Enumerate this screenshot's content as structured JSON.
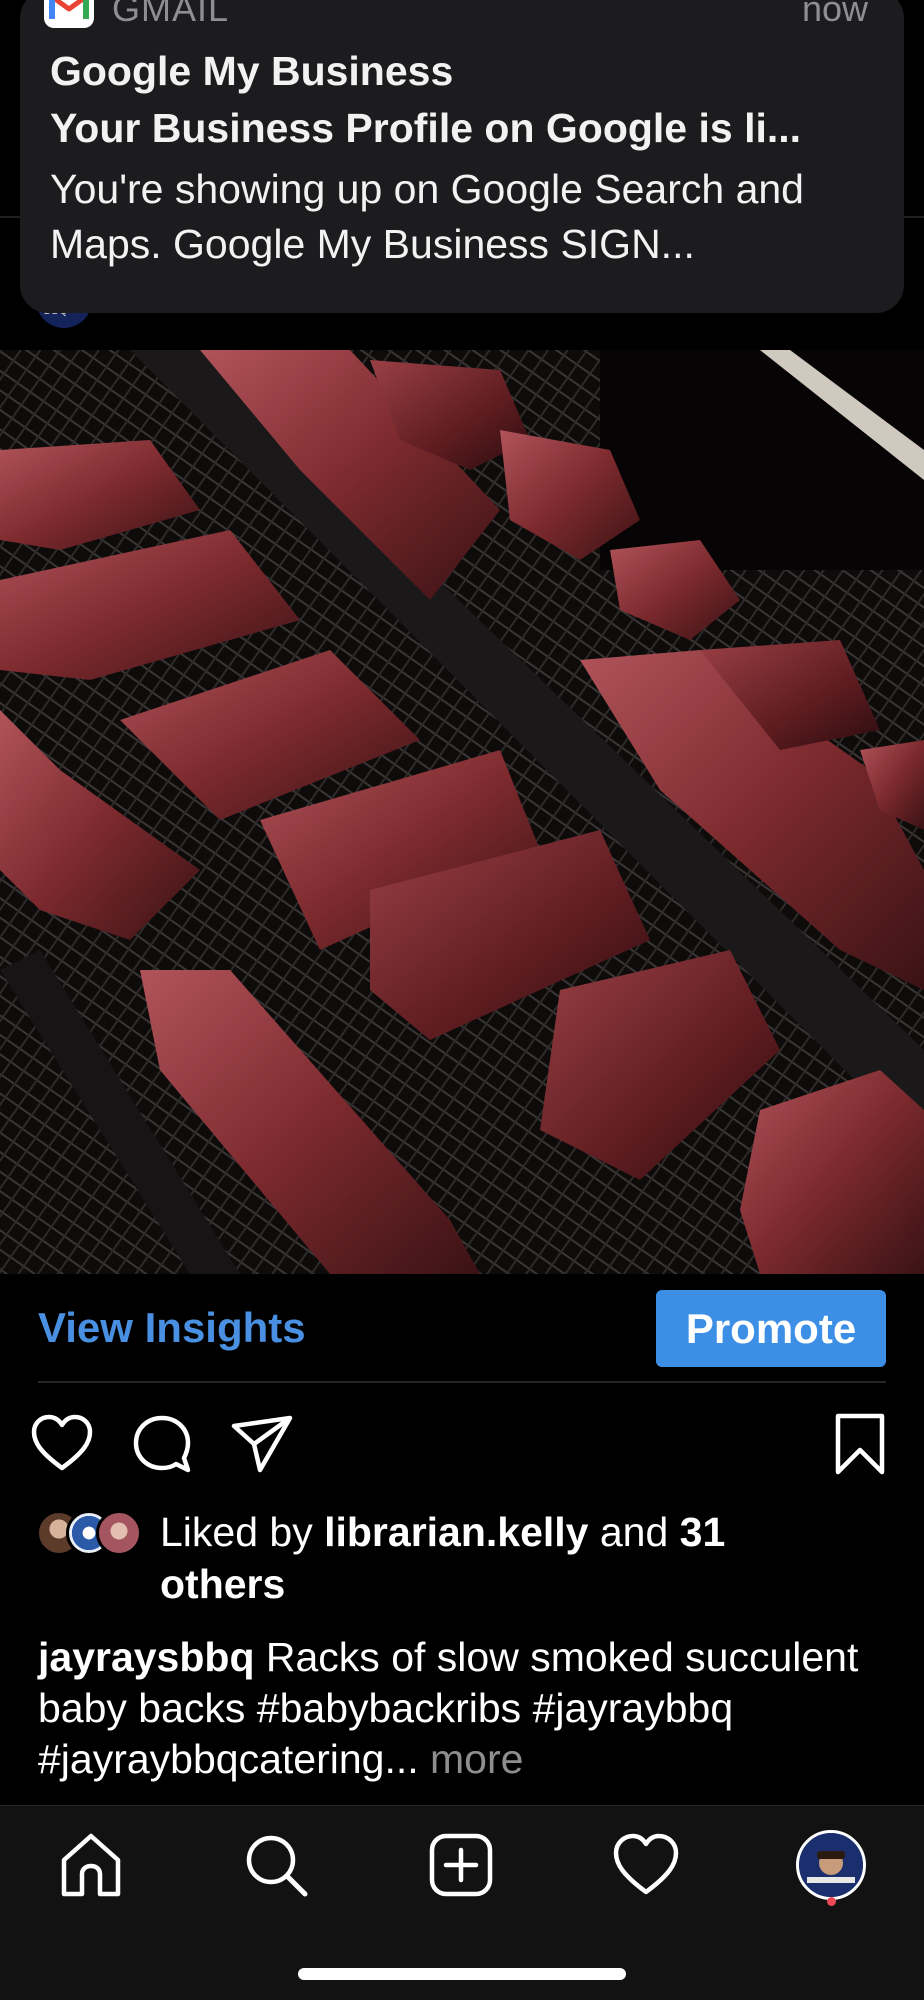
{
  "notification": {
    "app_name": "GMAIL",
    "time": "now",
    "title": "Google My Business",
    "subtitle": "Your Business Profile on Google is li...",
    "body": "You're showing up on Google Search and Maps. Google My Business SIGN..."
  },
  "post": {
    "view_insights_label": "View Insights",
    "promote_label": "Promote",
    "likes": {
      "prefix": "Liked by ",
      "user": "librarian.kelly",
      "conjunction": " and ",
      "count": "31 others"
    },
    "caption": {
      "username": "jayraysbbq",
      "text": " Racks of slow smoked succulent baby backs #babybackribs #jayraybbq #jayraybbqcatering...",
      "more": " more"
    }
  },
  "tab_bar": {
    "items": [
      "home-icon",
      "search-icon",
      "create-post-icon",
      "heart-icon",
      "profile-avatar"
    ]
  },
  "colors": {
    "link_blue": "#4a90e2",
    "promote_button": "#3d8fe6",
    "notification_bg": "#1c1c1e",
    "notification_badge": "#ed4956"
  }
}
